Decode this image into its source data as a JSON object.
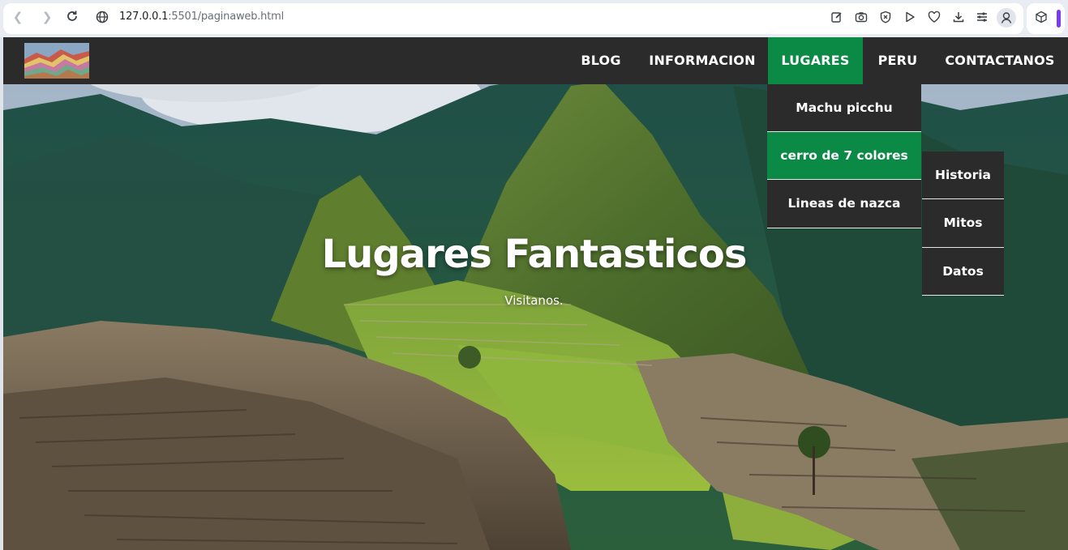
{
  "browser": {
    "url_host": "127.0.0.1",
    "url_rest": ":5501/paginaweb.html",
    "icons": [
      "back-icon",
      "forward-icon",
      "reload-icon",
      "site-info-icon",
      "edit-icon",
      "camera-icon",
      "shield-icon",
      "play-icon",
      "heart-icon",
      "download-icon",
      "menu-lines-icon",
      "profile-icon",
      "extension-cube-icon"
    ]
  },
  "nav": {
    "items": [
      {
        "label": "BLOG"
      },
      {
        "label": "INFORMACION"
      },
      {
        "label": "LUGARES"
      },
      {
        "label": "PERU"
      },
      {
        "label": "CONTACTANOS"
      }
    ],
    "active_color": "#0b8a45",
    "bar_color": "#2b2b2b"
  },
  "dropdown": {
    "items": [
      {
        "label": "Machu picchu"
      },
      {
        "label": "cerro de 7 colores"
      },
      {
        "label": "Lineas de nazca"
      }
    ],
    "submenu": [
      {
        "label": "Historia"
      },
      {
        "label": "Mitos"
      },
      {
        "label": "Datos"
      }
    ]
  },
  "hero": {
    "title": "Lugares Fantasticos",
    "subtitle": "Visitanos."
  }
}
